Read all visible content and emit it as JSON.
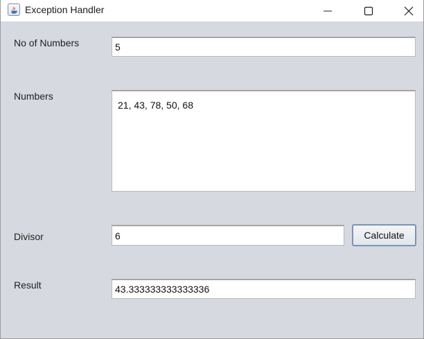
{
  "window": {
    "title": "Exception Handler"
  },
  "titlebar_icons": {
    "app": "java-icon",
    "minimize": "minimize-icon",
    "maximize": "maximize-icon",
    "close": "close-icon"
  },
  "form": {
    "count_label": "No of Numbers",
    "count_value": "5",
    "numbers_label": "Numbers",
    "numbers_value": "21, 43, 78, 50, 68",
    "divisor_label": "Divisor",
    "divisor_value": "6",
    "calculate_label": "Calculate",
    "result_label": "Result",
    "result_value": "43.333333333333336"
  },
  "colors": {
    "window_background": "#d6d9e0",
    "titlebar_background": "#ffffff",
    "button_border": "#7b93b6"
  }
}
